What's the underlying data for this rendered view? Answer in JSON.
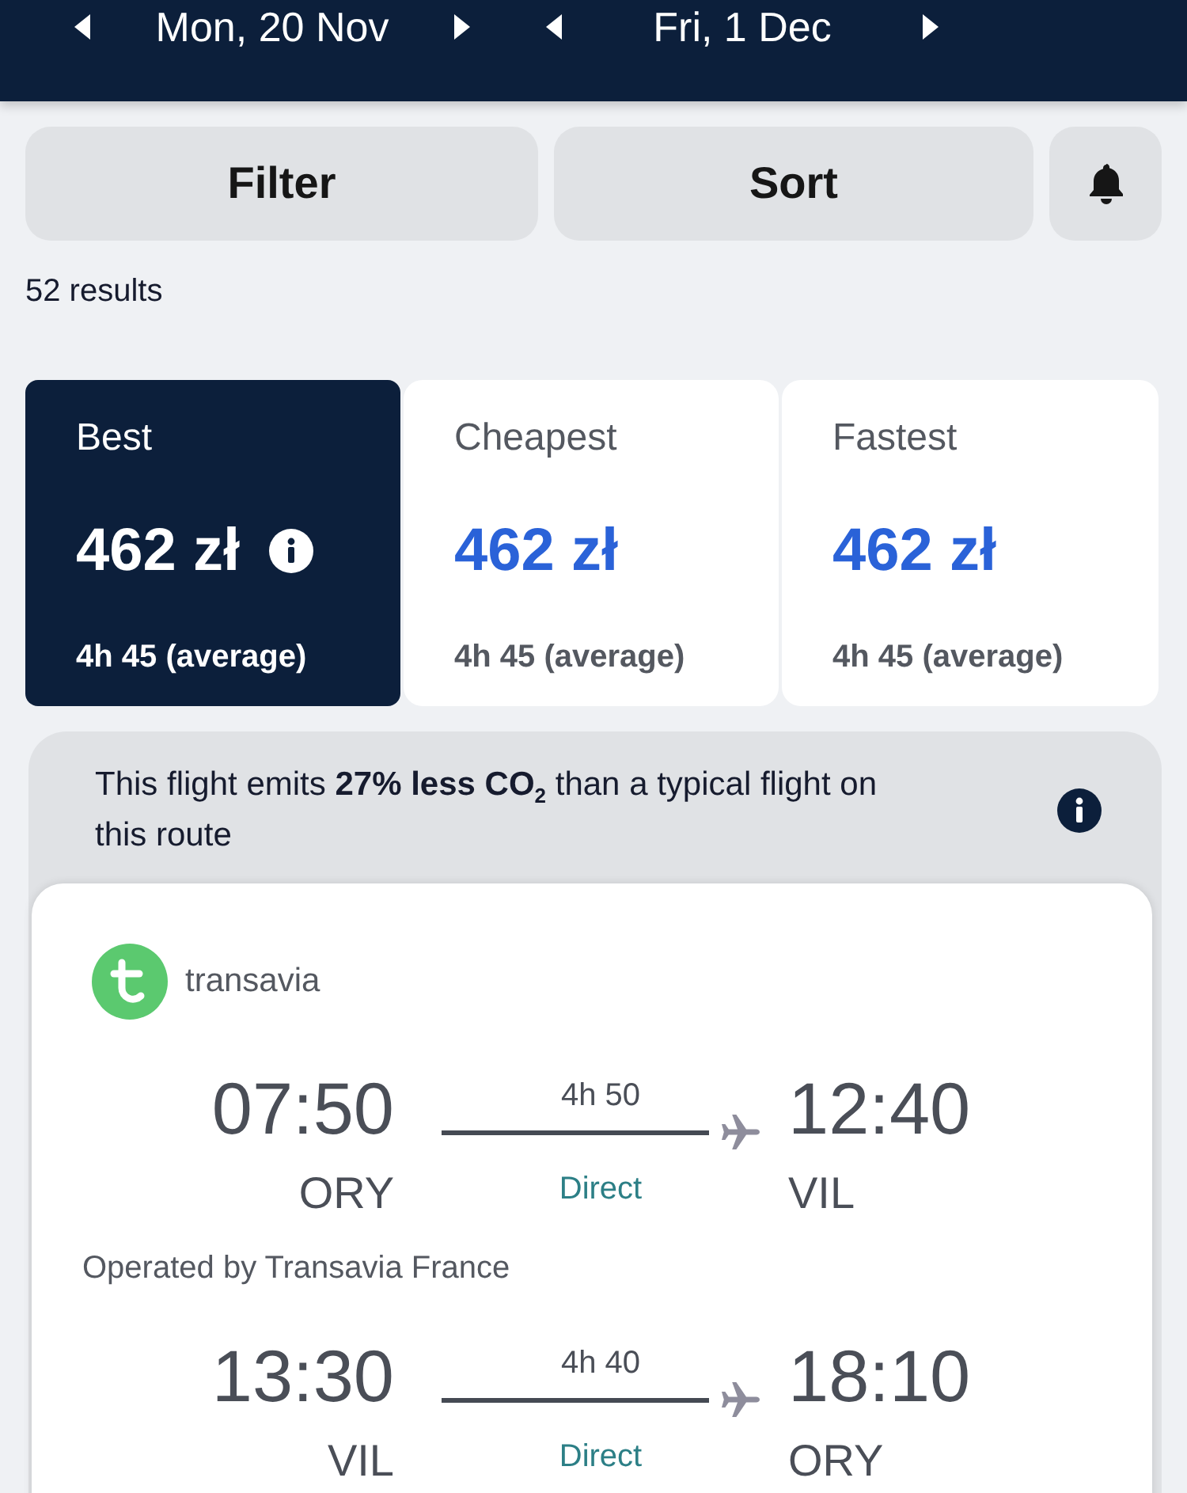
{
  "date_bar": [
    {
      "date": "Mon, 20 Nov"
    },
    {
      "date": "Fri, 1 Dec"
    }
  ],
  "actions": {
    "buttons": [
      "Filter",
      "Sort"
    ]
  },
  "results_count": "52 results",
  "sort_tabs": [
    {
      "label": "Best",
      "price": "462 zł",
      "duration": "4h 45 (average)",
      "info": true,
      "selected": true
    },
    {
      "label": "Cheapest",
      "price": "462 zł",
      "duration": "4h 45 (average)",
      "info": false,
      "selected": false
    },
    {
      "label": "Fastest",
      "price": "462 zł",
      "duration": "4h 45 (average)",
      "info": false,
      "selected": false
    }
  ],
  "eco_notice": {
    "text": "This flight emits **27% less CO$_{2}$** than a typical flight on this route"
  },
  "flight": {
    "airline": "transavia",
    "legs": [
      {
        "depart_time": "07:50",
        "depart_airport": "ORY",
        "duration": "4h 50",
        "stops": "Direct",
        "arrive_time": "12:40",
        "arrive_airport": "VIL",
        "operated_by": "Operated by Transavia France"
      },
      {
        "depart_time": "13:30",
        "depart_airport": "VIL",
        "duration": "4h 40",
        "stops": "Direct",
        "arrive_time": "18:10",
        "arrive_airport": "ORY"
      }
    ]
  }
}
